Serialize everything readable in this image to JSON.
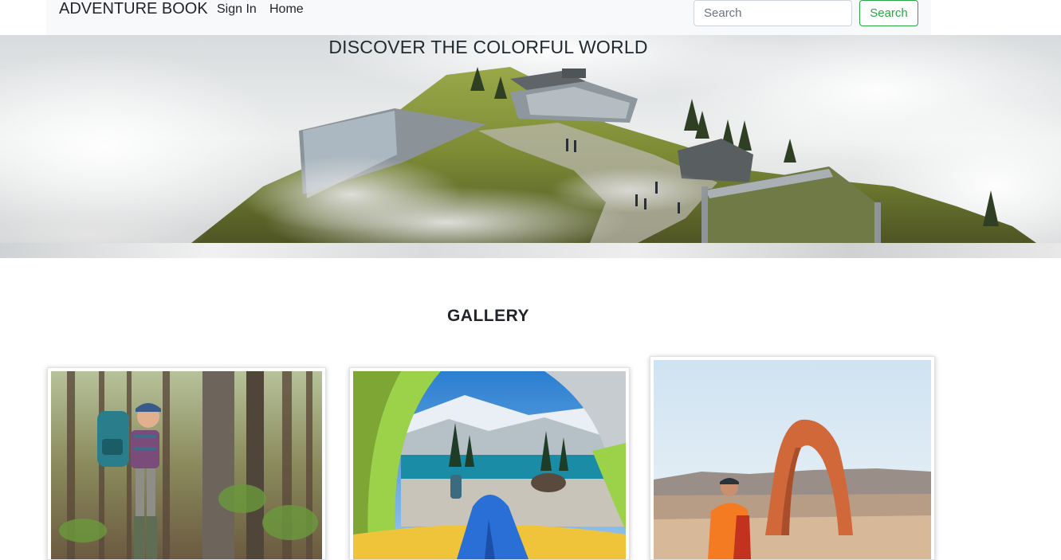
{
  "navbar": {
    "brand": "ADVENTURE BOOK",
    "links": [
      {
        "label": "Sign In"
      },
      {
        "label": "Home"
      }
    ],
    "search": {
      "placeholder": "Search",
      "value": "",
      "button_label": "Search"
    }
  },
  "hero": {
    "title": "DISCOVER THE COLORFUL WORLD"
  },
  "gallery": {
    "title": "GALLERY"
  },
  "colors": {
    "navbar_bg": "#f8f9fa",
    "search_accent": "#28a745",
    "text": "#212529"
  }
}
